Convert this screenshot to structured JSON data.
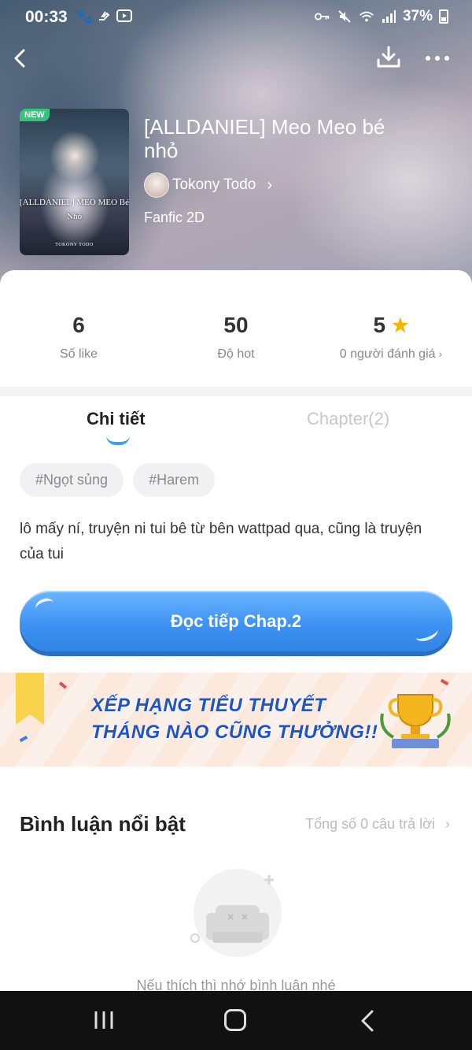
{
  "status_bar": {
    "time": "00:33",
    "battery": "37%",
    "left_icons": [
      "paw-icon",
      "hand-icon",
      "video-icon"
    ],
    "right_icons": [
      "key-icon",
      "mute-icon",
      "wifi-icon",
      "signal-icon",
      "battery-icon"
    ]
  },
  "book": {
    "badge": "NEW",
    "cover_title": "[ALLDANIEL] MEO MEO Bé Nhỏ",
    "cover_author": "TOKONY TODO",
    "title": "[ALLDANIEL] Meo Meo bé nhỏ",
    "author": "Tokony Todo",
    "genre": "Fanfic 2D"
  },
  "stats": {
    "likes_value": "6",
    "likes_label": "Số like",
    "hot_value": "50",
    "hot_label": "Độ hot",
    "rating_value": "5",
    "rating_label": "0 người đánh giá"
  },
  "tabs": {
    "detail": "Chi tiết",
    "chapter": "Chapter(2)"
  },
  "tags": [
    "#Ngọt sủng",
    "#Harem"
  ],
  "description": "lô mấy ní, truyện ni tui bê từ bên wattpad qua, cũng là truyện của tui",
  "read_button": "Đọc tiếp Chap.2",
  "banner": {
    "line1": "XẾP HẠNG TIỂU THUYẾT",
    "line2": "THÁNG NÀO CŨNG THƯỞNG!!"
  },
  "comments": {
    "title": "Bình luận nổi bật",
    "total": "Tổng số 0 câu trả lời",
    "empty_text": "Nếu thích thì nhớ bình luận nhé"
  },
  "colors": {
    "accent": "#3e93f2",
    "new_badge": "#34c47c",
    "star": "#f5b400",
    "banner_text": "#1f54c8"
  }
}
